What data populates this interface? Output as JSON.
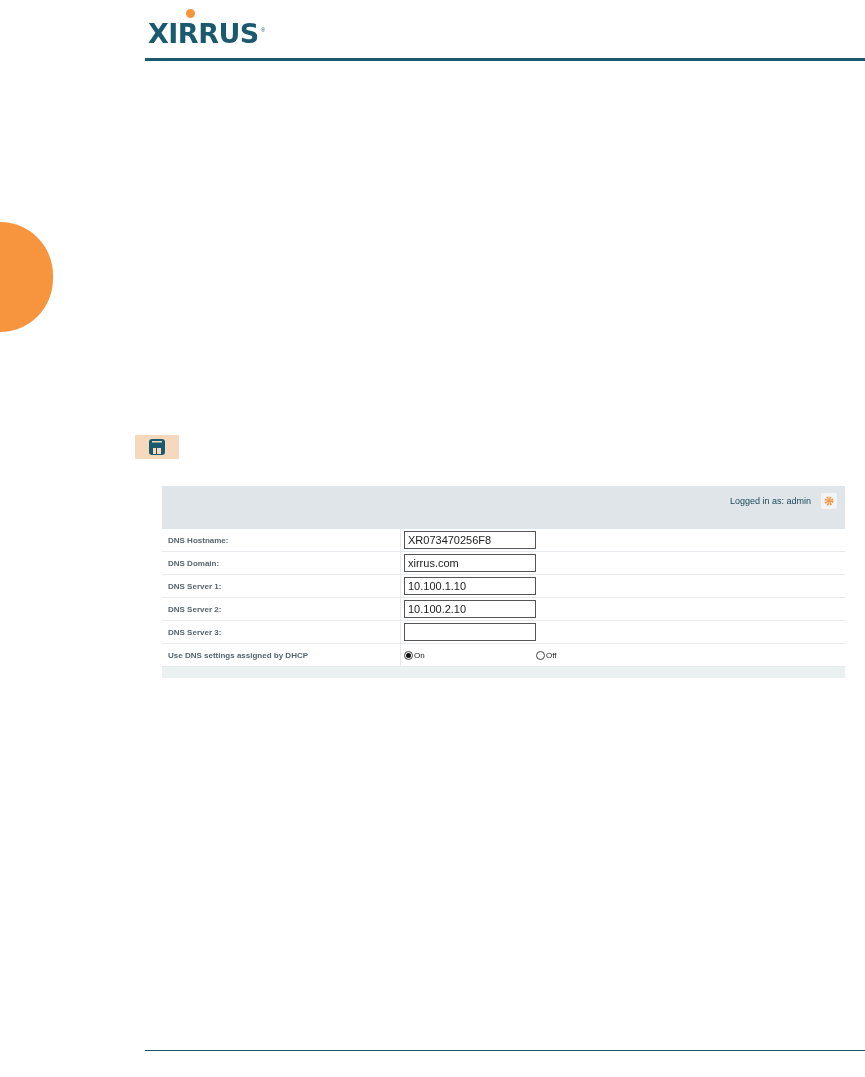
{
  "logo": {
    "text": "XIRRUS",
    "mark": "®"
  },
  "panel": {
    "login": "Logged in as: admin",
    "rows": [
      {
        "kind": "text",
        "label": "DNS Hostname:",
        "value": "XR073470256F8"
      },
      {
        "kind": "text",
        "label": "DNS Domain:",
        "value": "xirrus.com"
      },
      {
        "kind": "text",
        "label": "DNS Server 1:",
        "value": "10.100.1.10"
      },
      {
        "kind": "text",
        "label": "DNS Server 2:",
        "value": "10.100.2.10"
      },
      {
        "kind": "text",
        "label": "DNS Server 3:"
      },
      {
        "kind": "radio",
        "label": "Use DNS settings assigned by DHCP",
        "options": [
          {
            "label": "On",
            "selected": true
          },
          {
            "label": "Off",
            "selected": false
          }
        ]
      }
    ]
  }
}
